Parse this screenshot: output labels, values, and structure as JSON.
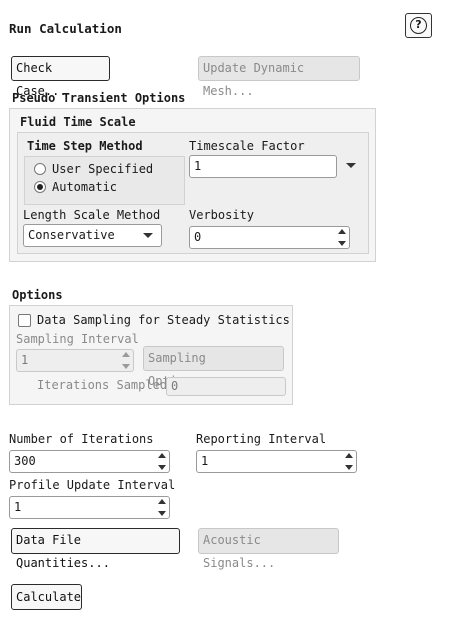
{
  "panel": {
    "title": "Run Calculation",
    "help_glyph": "?",
    "check_case_label": "Check Case...",
    "update_mesh_label": "Update Dynamic Mesh..."
  },
  "pseudo": {
    "title": "Pseudo Transient Options",
    "fluid_title": "Fluid Time Scale",
    "time_step_method_label": "Time Step Method",
    "user_specified_label": "User Specified",
    "automatic_label": "Automatic",
    "selected_method": "Automatic",
    "timescale_factor_label": "Timescale Factor",
    "timescale_factor_value": "1",
    "length_scale_label": "Length Scale Method",
    "length_scale_value": "Conservative",
    "verbosity_label": "Verbosity",
    "verbosity_value": "0"
  },
  "options": {
    "title": "Options",
    "data_sampling_label": "Data Sampling for Steady Statistics",
    "data_sampling_checked": false,
    "sampling_interval_label": "Sampling Interval",
    "sampling_interval_value": "1",
    "sampling_options_label": "Sampling Options...",
    "iterations_sampled_label": "Iterations Sampled",
    "iterations_sampled_value": "0"
  },
  "run": {
    "num_iterations_label": "Number of Iterations",
    "num_iterations_value": "300",
    "reporting_interval_label": "Reporting Interval",
    "reporting_interval_value": "1",
    "profile_update_label": "Profile Update Interval",
    "profile_update_value": "1",
    "data_file_quantities_label": "Data File Quantities...",
    "acoustic_signals_label": "Acoustic Signals...",
    "calculate_label": "Calculate"
  }
}
